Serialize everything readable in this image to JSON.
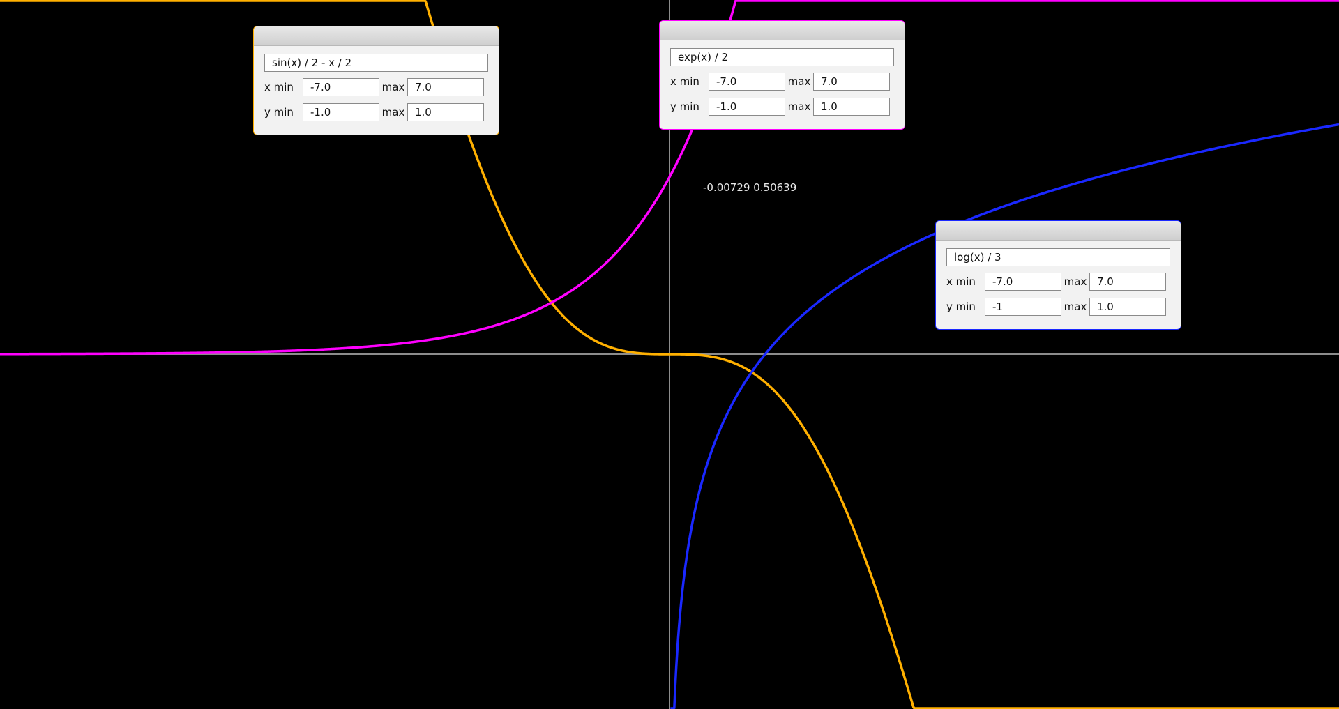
{
  "readout": {
    "text": "-0.00729 0.50639"
  },
  "plot": {
    "background": "#000000",
    "axis_color": "#8c8c8c"
  },
  "panels": [
    {
      "expression": "sin(x) / 2 - x / 2",
      "color": "#ffb000",
      "x_min_label": "x min",
      "y_min_label": "y min",
      "max_label": "max",
      "x_min": "-7.0",
      "x_max": "7.0",
      "y_min": "-1.0",
      "y_max": "1.0"
    },
    {
      "expression": "exp(x) / 2",
      "color": "#ff00ff",
      "x_min_label": "x min",
      "y_min_label": "y min",
      "max_label": "max",
      "x_min": "-7.0",
      "x_max": "7.0",
      "y_min": "-1.0",
      "y_max": "1.0"
    },
    {
      "expression": "log(x) / 3",
      "color": "#1a28ff",
      "x_min_label": "x min",
      "y_min_label": "y min",
      "max_label": "max",
      "x_min": "-7.0",
      "x_max": "7.0",
      "y_min": "-1",
      "y_max": "1.0"
    }
  ]
}
